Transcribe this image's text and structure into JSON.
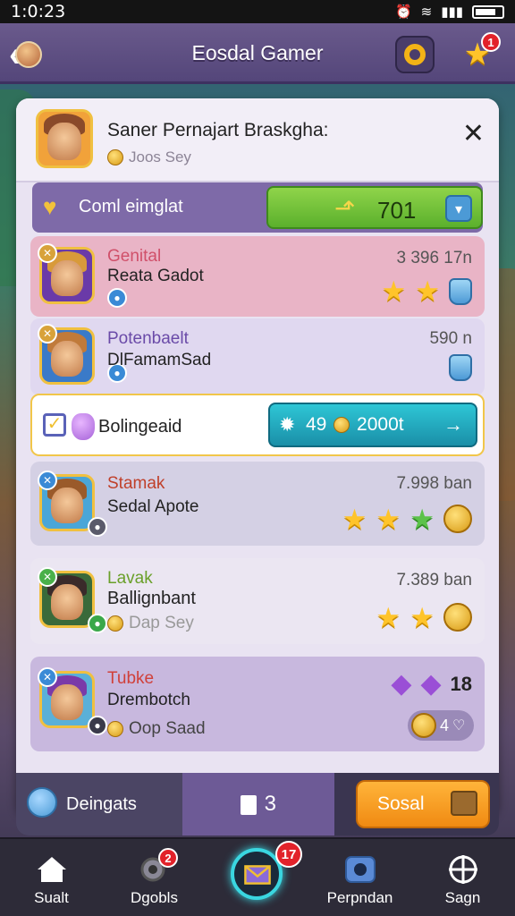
{
  "status_bar": {
    "time": "1:0:23"
  },
  "header": {
    "title": "Eosdal Gamer",
    "star_badge": "1"
  },
  "panel": {
    "player_name": "Saner Pernajart Braskgha:",
    "player_sub": "Joos Sey",
    "claim_label": "Coml eimglat",
    "claim_value": "701"
  },
  "rows": [
    {
      "name": "Genital",
      "subtitle": "Reata Gadot",
      "value": "3 396 17n"
    },
    {
      "name": "Potenbaelt",
      "subtitle": "DlFamamSad",
      "value": "590 n"
    },
    {
      "name": "Stamak",
      "subtitle": "Sedal Apote",
      "value": "7.998 ban"
    },
    {
      "name": "Lavak",
      "subtitle": "Ballignbant",
      "sub2": "Dap Sey",
      "value": "7.389 ban"
    },
    {
      "name": "Tubke",
      "subtitle": "Drembotch",
      "sub2": "Oop Saad",
      "value": "18",
      "chip_value": "4"
    }
  ],
  "highlight": {
    "label": "Bolingeaid",
    "button_prefix": "49",
    "button_value": "2000t"
  },
  "footer": {
    "left_label": "Deingats",
    "mid_label": "3",
    "right_label": "Sosal"
  },
  "nav": [
    {
      "label": "Sualt"
    },
    {
      "label": "Dgobls",
      "badge": "2"
    },
    {
      "label": "",
      "badge": "17"
    },
    {
      "label": "Perpndan"
    },
    {
      "label": "Sagn"
    }
  ],
  "colors": {
    "accent_purple": "#6a5a8c",
    "green_button": "#6cc23a",
    "teal_button": "#1fa9bf",
    "orange_button": "#f59a1e",
    "badge_red": "#e2222a"
  }
}
